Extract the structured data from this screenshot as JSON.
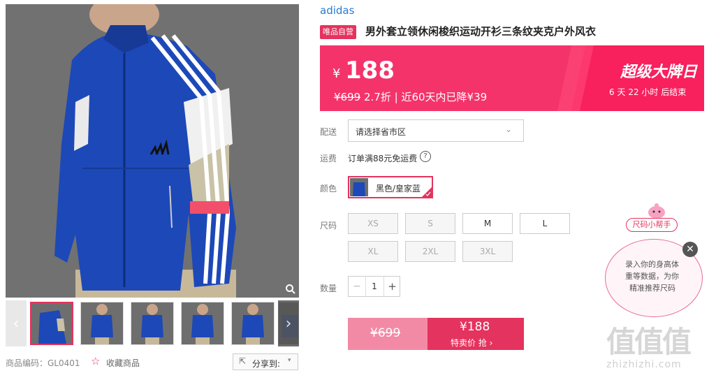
{
  "brand": "adidas",
  "product": {
    "tag": "唯品自营",
    "title": "男外套立领休闲梭织运动开衫三条纹夹克户外风衣"
  },
  "price": {
    "currency": "¥",
    "current": "188",
    "original": "¥699",
    "discount": "2.7折",
    "sep": "|",
    "history": "近60天内已降¥39",
    "promo_title": "超级大牌日",
    "countdown_days": "6",
    "countdown_day_unit": "天",
    "countdown_hours": "22",
    "countdown_hour_unit": "小时",
    "countdown_suffix": "后结束"
  },
  "shipping": {
    "label": "配送",
    "placeholder": "请选择省市区"
  },
  "freight": {
    "label": "运费",
    "text": "订单满88元免运费"
  },
  "color": {
    "label": "颜色",
    "option": "黑色/皇家蓝"
  },
  "size": {
    "label": "尺码",
    "options": [
      "XS",
      "S",
      "M",
      "L",
      "XL",
      "2XL",
      "3XL"
    ]
  },
  "quantity": {
    "label": "数量",
    "minus": "−",
    "value": "1",
    "plus": "+"
  },
  "buy": {
    "original": "¥699",
    "price": "¥188",
    "action": "特卖价 抢 ›"
  },
  "helper": {
    "title": "尺码小帮手",
    "line1": "录入你的身高体",
    "line2": "重等数据，为你",
    "line3": "精准推荐尺码"
  },
  "footer": {
    "sku_label": "商品编码：GL0401",
    "favorite": "收藏商品",
    "share": "分享到:"
  },
  "watermark": {
    "logo": "值值值",
    "url": "zhizhizhi.com"
  },
  "colors": {
    "accent": "#e4335e",
    "banner": "#f4336a",
    "link": "#2a7ad0"
  }
}
